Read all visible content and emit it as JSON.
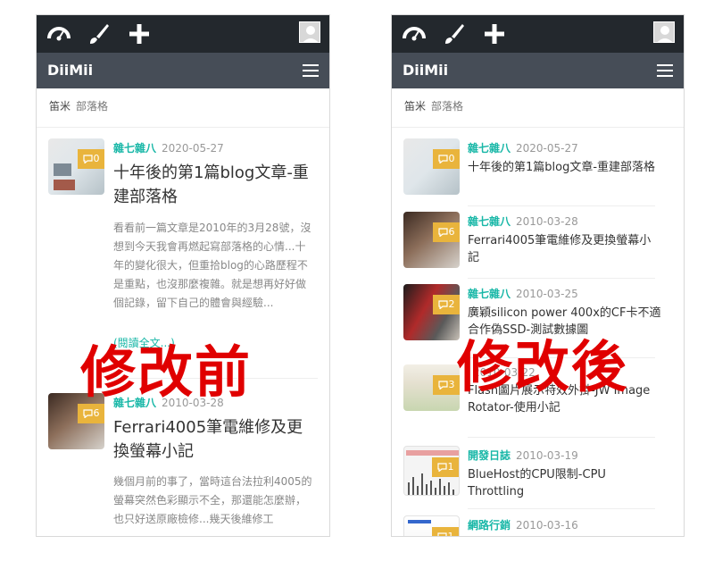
{
  "left": {
    "brand": "DiiMii",
    "breadcrumb": {
      "main": "笛米",
      "sub": "部落格"
    },
    "posts": [
      {
        "category": "雜七雜八",
        "date": "2020-05-27",
        "comments": "0",
        "title": "十年後的第1篇blog文章-重建部落格",
        "excerpt": "看看前一篇文章是2010年的3月28號，沒想到今天我會再燃起寫部落格的心情...十年的變化很大，但重拾blog的心路歷程不是重點，也沒那麼複雜。就是想再好好做個記錄，留下自己的體會與經驗...",
        "readmore": "(閱讀全文...)"
      },
      {
        "category": "雜七雜八",
        "date": "2010-03-28",
        "comments": "6",
        "title": "Ferrari4005筆電維修及更換螢幕小記",
        "excerpt": "幾個月前的事了，當時這台法拉利4005的螢幕突然色彩顯示不全，那還能怎麼辦，也只好送原廠檢修...幾天後維修工"
      }
    ]
  },
  "right": {
    "brand": "DiiMii",
    "breadcrumb": {
      "main": "笛米",
      "sub": "部落格"
    },
    "posts": [
      {
        "category": "雜七雜八",
        "date": "2020-05-27",
        "comments": "0",
        "title": "十年後的第1篇blog文章-重建部落格"
      },
      {
        "category": "雜七雜八",
        "date": "2010-03-28",
        "comments": "6",
        "title": "Ferrari4005筆電維修及更換螢幕小記"
      },
      {
        "category": "雜七雜八",
        "date": "2010-03-25",
        "comments": "2",
        "title": "廣穎silicon power 400x的CF卡不適合作偽SSD-測試數據圖"
      },
      {
        "category": "",
        "date": "2010-03-22",
        "comments": "3",
        "title": "Flash圖片展示特效外掛-JW Image Rotator-使用小記"
      },
      {
        "category": "開發日誌",
        "date": "2010-03-19",
        "comments": "1",
        "title": "BlueHost的CPU限制-CPU Throttling"
      },
      {
        "category": "網路行銷",
        "date": "2010-03-16",
        "comments": "1",
        "title": ""
      }
    ]
  },
  "overlays": {
    "before": "修改前",
    "after": "修改後"
  },
  "colors": {
    "topbar": "#23282d",
    "navbar": "#464d57",
    "accent": "#18b7a7",
    "badge": "#e9b43c",
    "overlay": "#e00000"
  }
}
